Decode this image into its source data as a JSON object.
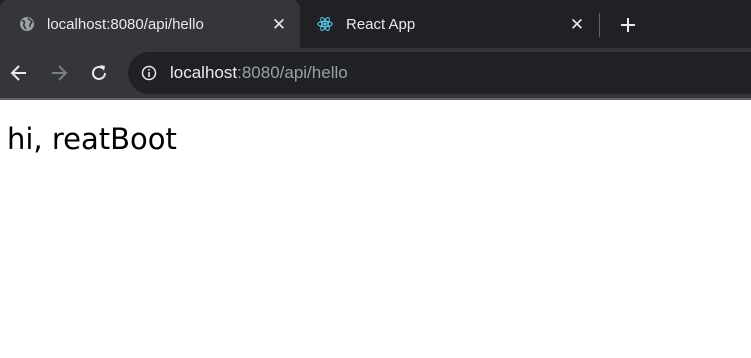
{
  "tabs": [
    {
      "title": "localhost:8080/api/hello",
      "favicon": "globe-icon",
      "active": true
    },
    {
      "title": "React App",
      "favicon": "react-logo-icon",
      "active": false
    }
  ],
  "toolbar": {
    "back_icon": "back-arrow-icon",
    "forward_icon": "forward-arrow-icon",
    "reload_icon": "reload-icon",
    "info_icon": "info-icon",
    "url_host": "localhost",
    "url_rest": ":8080/api/hello"
  },
  "page": {
    "text": "hi, reatBoot"
  },
  "colors": {
    "tabstrip": "#202124",
    "active_tab": "#35363a",
    "omnibox": "#202124",
    "react_blue": "#61dafb",
    "page_bg": "#ffffff"
  }
}
